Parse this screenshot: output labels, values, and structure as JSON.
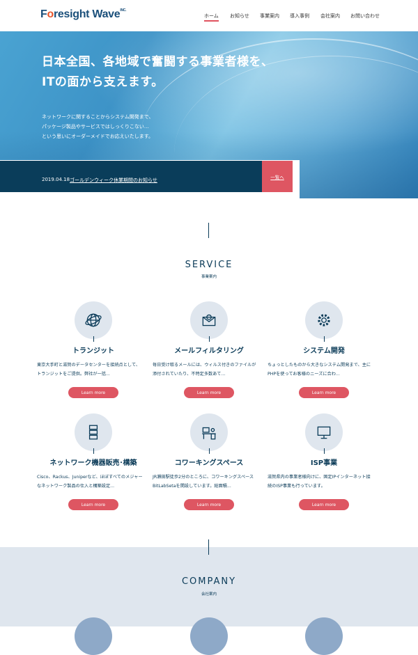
{
  "header": {
    "logo": {
      "pre": "F",
      "o": "o",
      "post": "resight Wave",
      "sup": "INC."
    },
    "nav": [
      "ホーム",
      "お知らせ",
      "事業案内",
      "導入事例",
      "会社案内",
      "お問い合わせ"
    ]
  },
  "hero": {
    "headline": [
      "日本全国、各地域で奮闘する事業者様を、",
      "ITの面から支えます。"
    ],
    "sub": [
      "ネットワークに関することからシステム開発まで、",
      "パッケージ製品やサービスではしっくりこない…",
      "という思いにオーダーメイドでお応えいたします。"
    ]
  },
  "news": {
    "date": "2019.04.18",
    "title": "ゴールデンウィーク休業期間のお知らせ",
    "list_label": "一覧へ"
  },
  "service": {
    "title": "SERVICE",
    "subtitle": "事業案内",
    "items": [
      {
        "icon": "globe-icon",
        "title": "トランジット",
        "text": [
          "東京大手町と滋賀のデータセンターを接続点として、",
          "トランジットをご提供。弊社が一括..."
        ],
        "button": "Learn more"
      },
      {
        "icon": "mail-icon",
        "title": "メールフィルタリング",
        "text": [
          "毎日受け取るメールには、ウィルス付きのファイルが",
          "添付されていたり、不特定多数あて..."
        ],
        "button": "Learn more"
      },
      {
        "icon": "gear-icon",
        "title": "システム開発",
        "text": [
          "ちょっとしたものから大きなシステム開発まで、主に",
          "PHPを使ってお客様のニーズに合わ..."
        ],
        "button": "Learn more"
      },
      {
        "icon": "server-icon",
        "title": "ネットワーク機器販売･構築",
        "text": [
          "Cisco、Rackus、Juniperなど、ほぼすべてのメジャー",
          "なネットワーク製品の仕入と構築設定..."
        ],
        "button": "Learn more"
      },
      {
        "icon": "desk-icon",
        "title": "コワーキングスペース",
        "text": [
          "JR瀬田駅徒歩2分のところに、コワーキングスペース",
          "BitLabSetaを開設しています。総面積..."
        ],
        "button": "Learn more"
      },
      {
        "icon": "monitor-icon",
        "title": "ISP事業",
        "text": [
          "滋賀県内の事業者様向けに、固定IPインターネット接",
          "続のISP事業も行っています。"
        ],
        "button": "Learn more"
      }
    ]
  },
  "company": {
    "title": "COMPANY",
    "subtitle": "会社案内"
  },
  "colors": {
    "navy": "#0b3b58",
    "accent": "#de5662",
    "light": "#dfe6ee"
  }
}
